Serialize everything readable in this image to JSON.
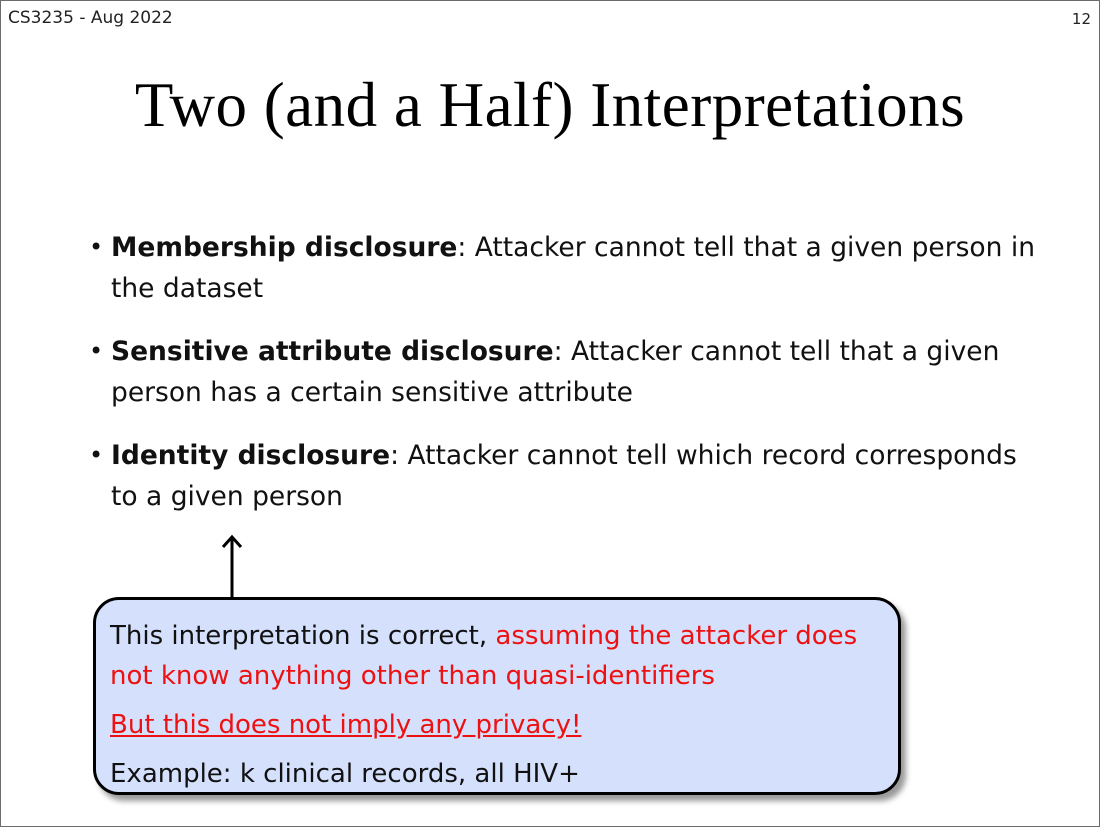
{
  "header": {
    "course": "CS3235 - Aug 2022",
    "page_number": "12"
  },
  "title": "Two (and a Half) Interpretations",
  "bullets": [
    {
      "term": "Membership disclosure",
      "text": ": Attacker cannot tell that a given person in the dataset"
    },
    {
      "term": "Sensitive attribute disclosure",
      "text": ": Attacker cannot tell that a given person has a certain sensitive attribute"
    },
    {
      "term": "Identity disclosure",
      "text": ": Attacker cannot tell which record corresponds to a given person"
    }
  ],
  "bullet_symbol": "•",
  "callout": {
    "line1_black": "This interpretation is correct, ",
    "line1_red": "assuming the attacker does not know anything other than quasi-identifiers",
    "line2_red_underlined": "But this does not imply any privacy!",
    "line3": "Example: k clinical records, all HIV+"
  },
  "colors": {
    "callout_bg": "#d4e0fc",
    "emphasis_red": "#ee1111"
  }
}
